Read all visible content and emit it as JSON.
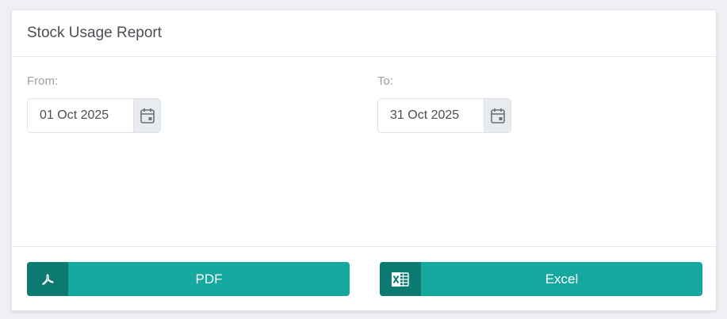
{
  "report": {
    "title": "Stock Usage Report"
  },
  "from": {
    "label": "From:",
    "value": "01 Oct 2025"
  },
  "to": {
    "label": "To:",
    "value": "31 Oct 2025"
  },
  "actions": {
    "pdf_label": "PDF",
    "pdf_icon": "pdf-icon",
    "excel_label": "Excel",
    "excel_icon": "excel-icon"
  },
  "colors": {
    "accent": "#14a89e",
    "accent_dark": "#0d7a71"
  }
}
